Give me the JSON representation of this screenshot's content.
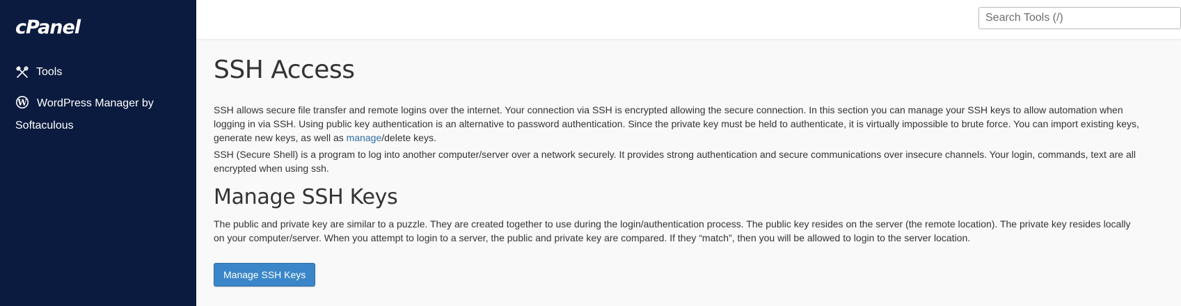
{
  "sidebar": {
    "logo": "cPanel",
    "items": [
      {
        "label": "Tools",
        "icon": "tools-icon"
      },
      {
        "label": "WordPress Manager by Softaculous",
        "icon": "wordpress-icon"
      }
    ]
  },
  "search": {
    "placeholder": "Search Tools (/)"
  },
  "main": {
    "title": "SSH Access",
    "intro_before_link": "SSH allows secure file transfer and remote logins over the internet. Your connection via SSH is encrypted allowing the secure connection. In this section you can manage your SSH keys to allow automation when logging in via SSH. Using public key authentication is an alternative to password authentication. Since the private key must be held to authenticate, it is virtually impossible to brute force. You can import existing keys, generate new keys, as well as ",
    "intro_link": "manage",
    "intro_after_link": "/delete keys.",
    "description": "SSH (Secure Shell) is a program to log into another computer/server over a network securely. It provides strong authentication and secure communications over insecure channels. Your login, commands, text are all encrypted when using ssh.",
    "section_title": "Manage SSH Keys",
    "section_text": "The public and private key are similar to a puzzle. They are created together to use during the login/authentication process. The public key resides on the server (the remote location). The private key resides locally on your computer/server. When you attempt to login to a server, the public and private key are compared. If they “match”, then you will be allowed to login to the server location.",
    "button_label": "Manage SSH Keys"
  },
  "colors": {
    "sidebar_bg": "#0b1b3f",
    "link": "#2f6aa6",
    "button": "#3a86c8"
  }
}
